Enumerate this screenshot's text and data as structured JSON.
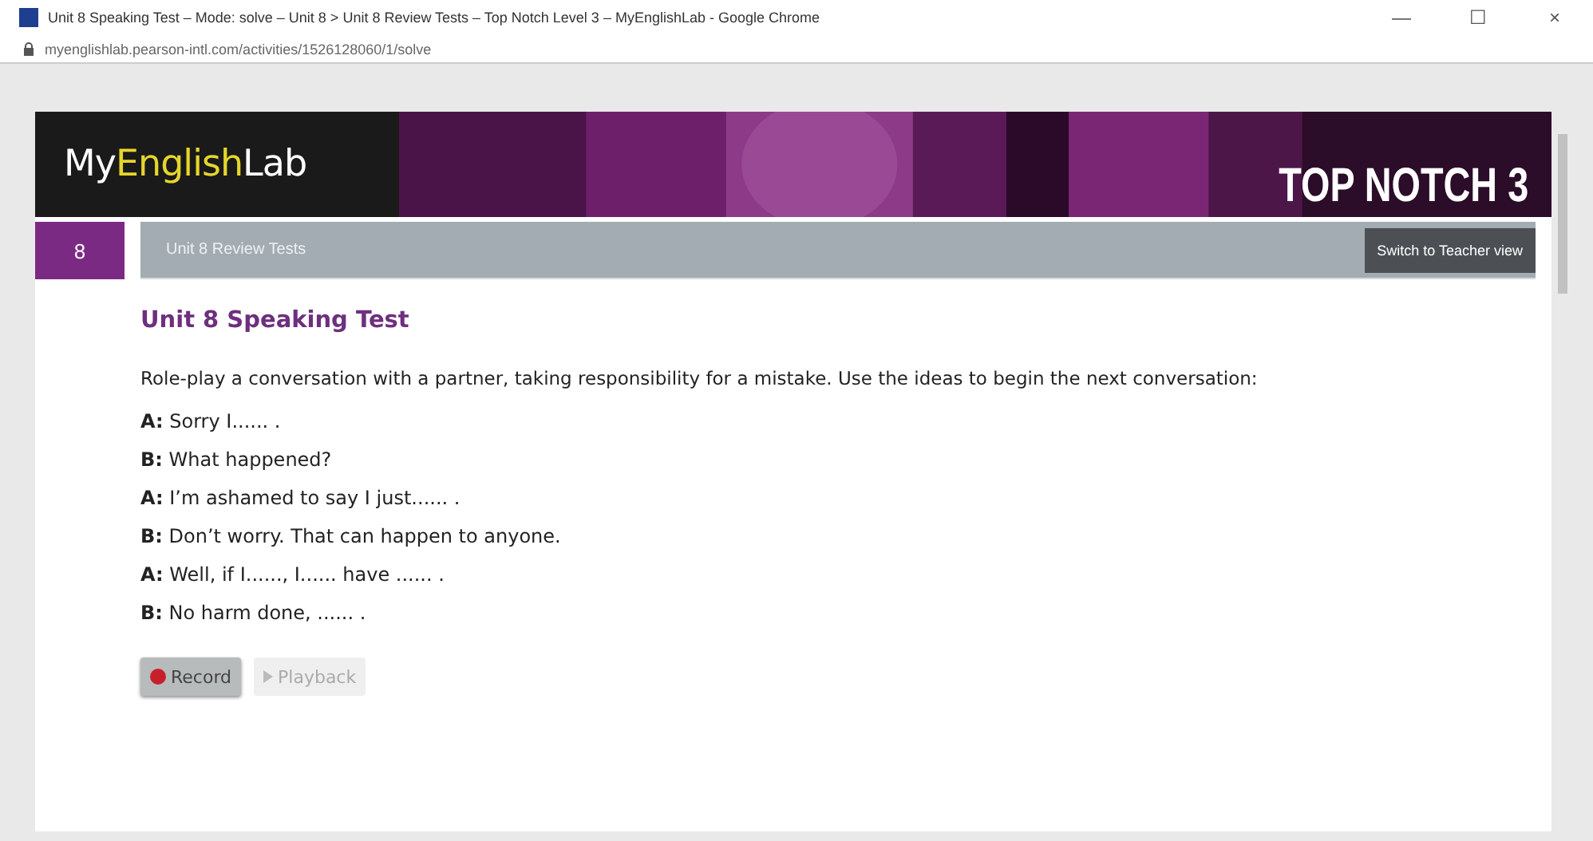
{
  "window": {
    "title": "Unit 8 Speaking Test – Mode: solve – Unit 8 > Unit 8 Review Tests – Top Notch Level 3 – MyEnglishLab - Google Chrome",
    "controls": [
      "—",
      "☐",
      "×"
    ]
  },
  "address_bar": {
    "url": "myenglishlab.pearson-intl.com/activities/1526128060/1/solve"
  },
  "header": {
    "logo": [
      {
        "text": "My",
        "highlight": false
      },
      {
        "text": "English",
        "highlight": true
      },
      {
        "text": "Lab",
        "highlight": false
      }
    ],
    "course": "TOP NOTCH 3"
  },
  "unit_bar": {
    "unit": "8",
    "title": "Unit 8 Review Tests",
    "button": "Switch to Teacher view"
  },
  "test": {
    "title": "Unit 8 Speaking Test",
    "instructions": "Role-play a conversation with a partner, taking responsibility for a mistake. Use the ideas to begin the next conversation:",
    "lines": [
      {
        "text": "**A:** Sorry I...... ."
      },
      {
        "text": "**B:** What happened?"
      },
      {
        "text": "**A:** I’m ashamed to say I just...... ."
      },
      {
        "text": "**B:** Don’t worry. That can happen to anyone."
      },
      {
        "text": "**A:** Well, if I......, I...... have ...... ."
      },
      {
        "text": "**B:** No harm done, ...... ."
      }
    ],
    "buttons": [
      {
        "kind": "record",
        "label": "Record",
        "disabled": false
      },
      {
        "kind": "playback",
        "label": "Playback",
        "disabled": true
      }
    ]
  }
}
